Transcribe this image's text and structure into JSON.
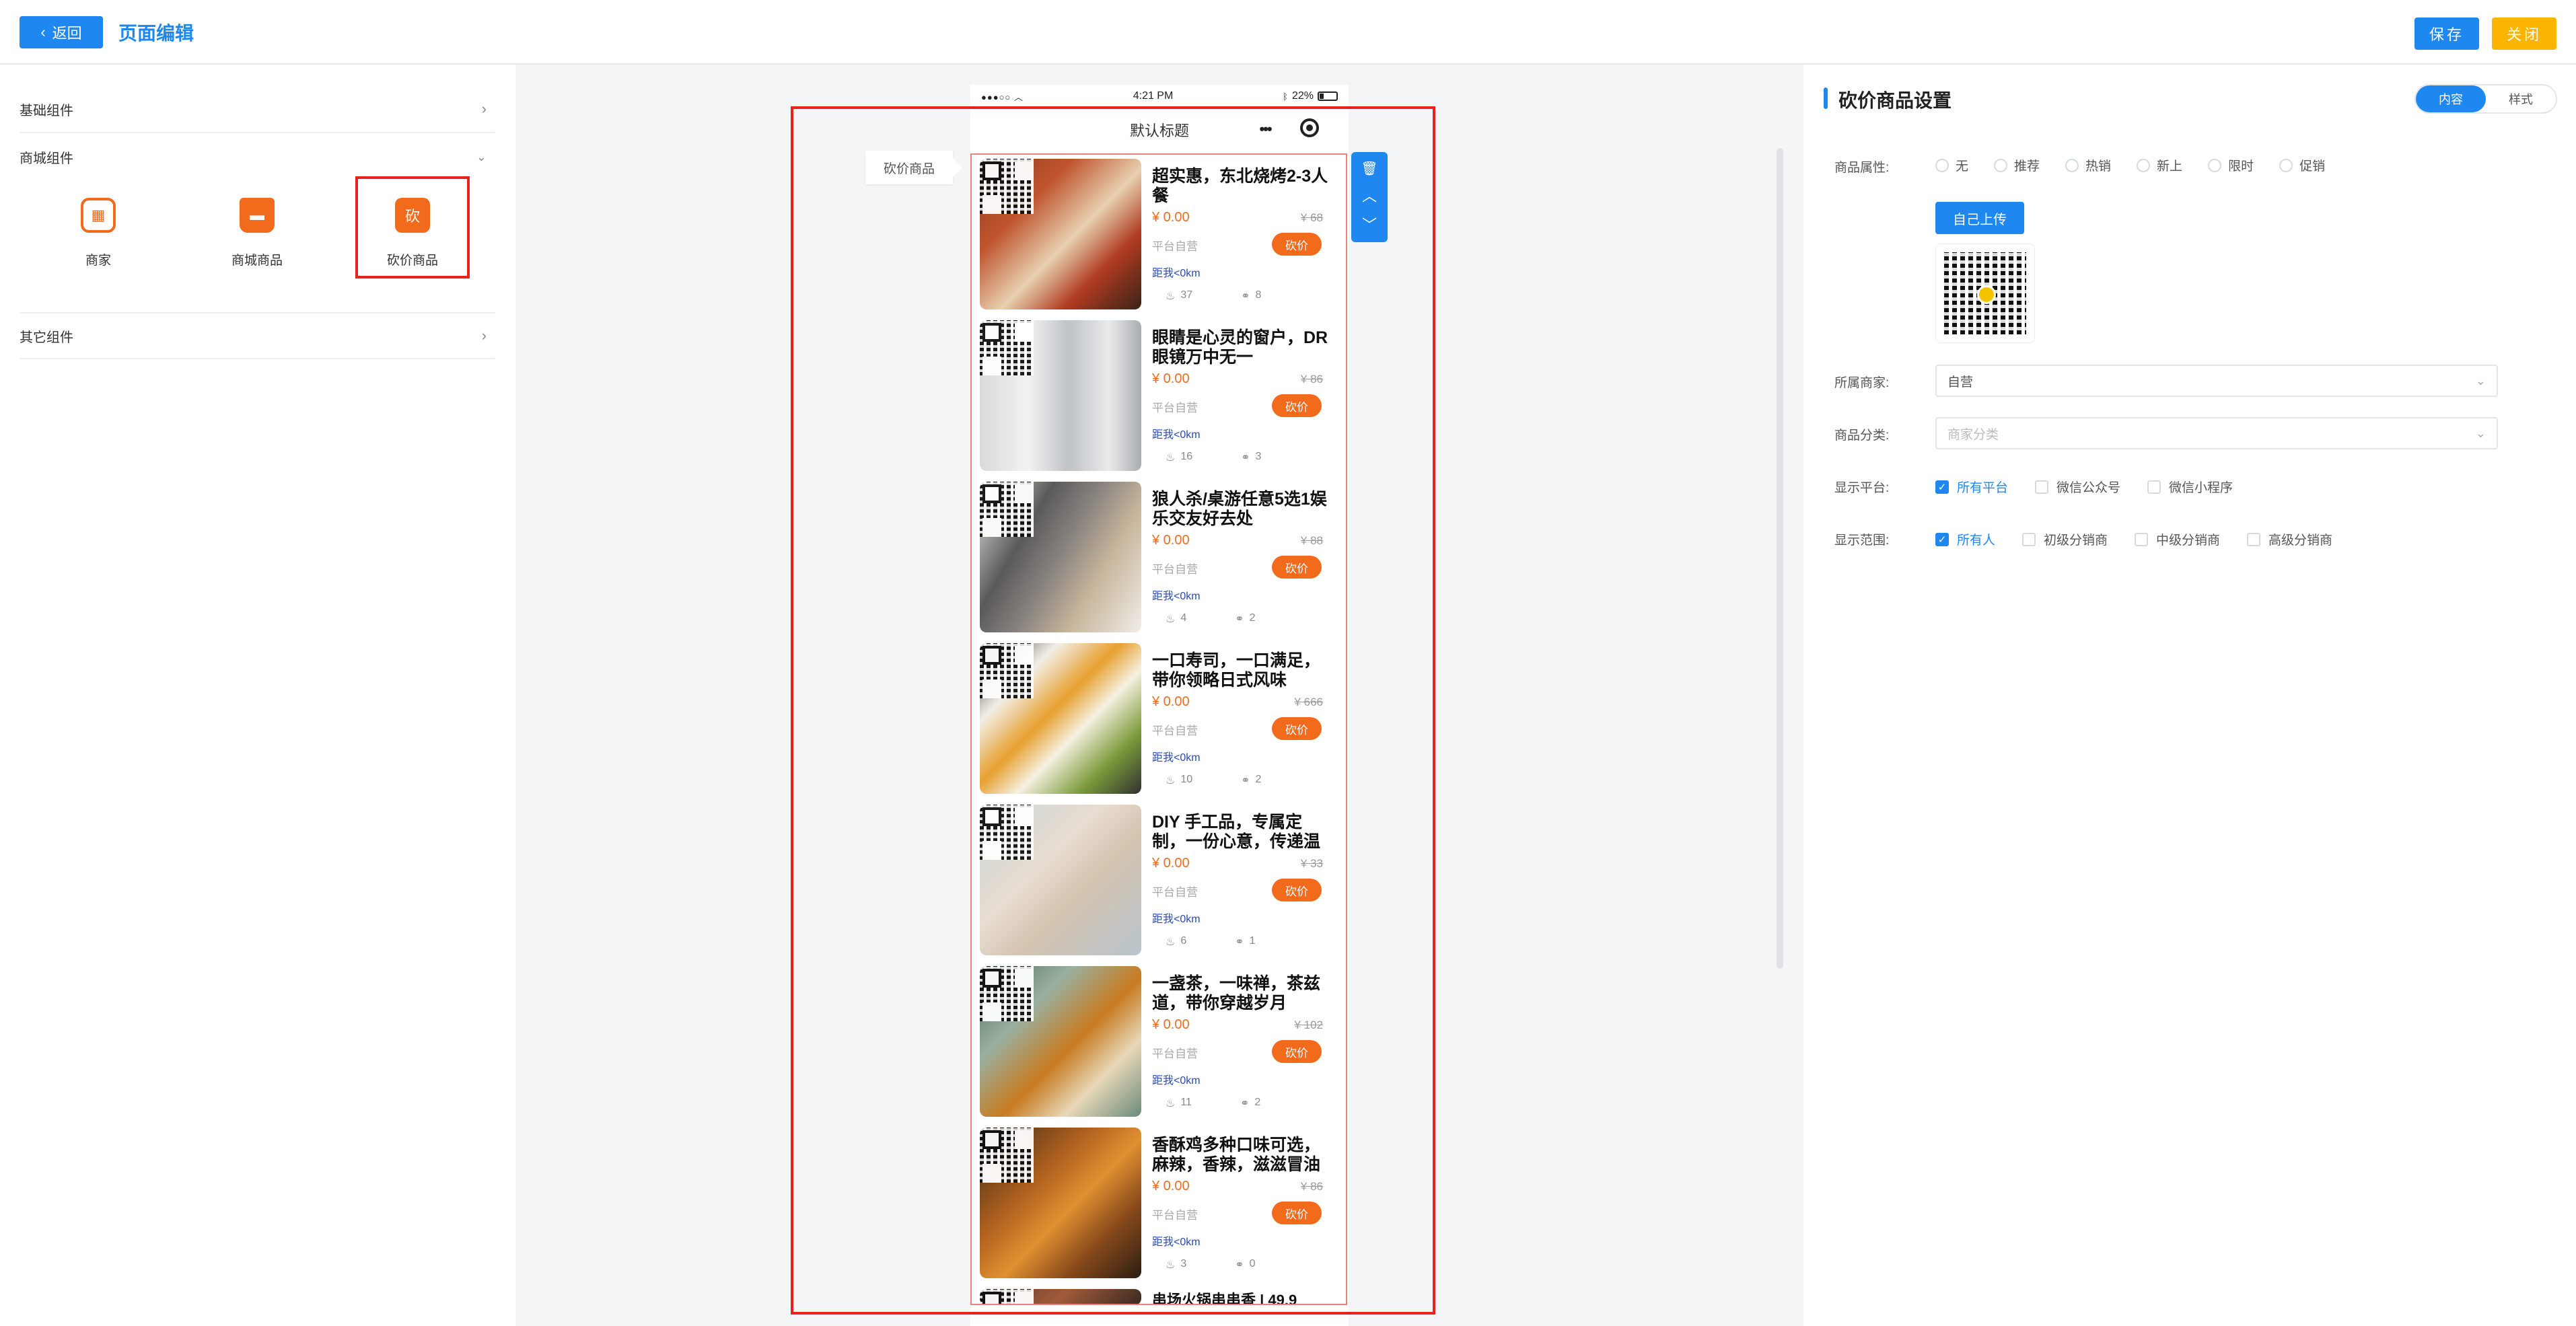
{
  "header": {
    "back_label": "返回",
    "title": "页面编辑",
    "save_label": "保存",
    "close_label": "关闭"
  },
  "left": {
    "groups": [
      {
        "label": "基础组件"
      },
      {
        "label": "商城组件"
      },
      {
        "label": "其它组件"
      }
    ],
    "components": [
      {
        "label": "商家",
        "icon": "store-icon",
        "color": "#f26a1b"
      },
      {
        "label": "商城商品",
        "icon": "shopping-bag-icon",
        "color": "#f26a1b"
      },
      {
        "label": "砍价商品",
        "icon": "bargain-icon",
        "icon_text": "砍",
        "color": "#f26a1b"
      }
    ]
  },
  "phone": {
    "status_left": "●●●○○ ︿",
    "time": "4:21 PM",
    "battery": "22%",
    "nav_title": "默认标题",
    "nav_more": "•••"
  },
  "canvas": {
    "component_tag": "砍价商品"
  },
  "products": [
    {
      "title": "超实惠，东北烧烤2-3人餐",
      "price": "¥ 0.00",
      "orig": "¥ 68",
      "seller": "平台自营",
      "btn": "砍价",
      "dist": "距我<0km",
      "views": "37",
      "shares": "8",
      "img": "linear-gradient(135deg,#8a3a1e 0%,#c0552e 30%,#e8d0b0 55%,#b03a20 75%,#3a2418 100%)"
    },
    {
      "title": "眼睛是心灵的窗户，DR眼镜万中无一",
      "price": "¥ 0.00",
      "orig": "¥ 86",
      "seller": "平台自营",
      "btn": "砍价",
      "dist": "距我<0km",
      "views": "16",
      "shares": "3",
      "img": "linear-gradient(90deg,#d8dadc 0%,#f2f2f2 30%,#bfc3c6 55%,#e9eaeb 80%,#a9adb0 100%)"
    },
    {
      "title": "狼人杀/桌游任意5选1娱乐交友好去处",
      "price": "¥ 0.00",
      "orig": "¥ 88",
      "seller": "平台自营",
      "btn": "砍价",
      "dist": "距我<0km",
      "views": "4",
      "shares": "2",
      "img": "linear-gradient(120deg,#e9e6e0 0%,#5a5a5a 30%,#8a8480 50%,#c6b59a 70%,#f0ede8 100%)"
    },
    {
      "title": "一口寿司，一口满足，带你领略日式风味",
      "price": "¥ 0.00",
      "orig": "¥ 666",
      "seller": "平台自营",
      "btn": "砍价",
      "dist": "距我<0km",
      "views": "10",
      "shares": "2",
      "img": "linear-gradient(135deg,#2a2a2a 0%,#f2efe8 25%,#e8a030 45%,#f5f0e0 60%,#7a9a3a 80%,#303030 100%)"
    },
    {
      "title": "DIY 手工品，专属定制，一份心意，传递温暖",
      "price": "¥ 0.00",
      "orig": "¥ 33",
      "seller": "平台自营",
      "btn": "砍价",
      "dist": "距我<0km",
      "views": "6",
      "shares": "1",
      "img": "linear-gradient(135deg,#c9d4da 0%,#e8ddd0 40%,#d4c4b0 60%,#b8c4cc 100%)"
    },
    {
      "title": "一盏茶，一味禅，茶兹道，带你穿越岁月",
      "price": "¥ 0.00",
      "orig": "¥ 102",
      "seller": "平台自营",
      "btn": "砍价",
      "dist": "距我<0km",
      "views": "11",
      "shares": "2",
      "img": "linear-gradient(135deg,#4a6a5a 0%,#9ab0a0 30%,#c87a20 55%,#e8d8b8 75%,#6a8a7a 100%)"
    },
    {
      "title": "香酥鸡多种口味可选，麻辣，香辣，滋滋冒油",
      "price": "¥ 0.00",
      "orig": "¥ 86",
      "seller": "平台自营",
      "btn": "砍价",
      "dist": "距我<0km",
      "views": "3",
      "shares": "0",
      "img": "linear-gradient(135deg,#3a2a1a 0%,#b0601e 35%,#e09030 55%,#8a4a1a 75%,#2a1e14 100%)"
    },
    {
      "title": "串场火锅串串香 | 49.9",
      "price": "",
      "orig": "",
      "seller": "",
      "btn": "",
      "dist": "",
      "views": "",
      "shares": "",
      "img": "linear-gradient(135deg,#5a3a2a 0%,#a05a3a 50%,#3a2a20 100%)"
    }
  ],
  "settings": {
    "title": "砍价商品设置",
    "tabs": [
      {
        "label": "内容"
      },
      {
        "label": "样式"
      }
    ],
    "attr_label": "商品属性:",
    "attrs": [
      "无",
      "推荐",
      "热销",
      "新上",
      "限时",
      "促销"
    ],
    "upload_label": "自己上传",
    "merchant_label": "所属商家:",
    "merchant_value": "自营",
    "category_label": "商品分类:",
    "category_placeholder": "商家分类",
    "platform_label": "显示平台:",
    "platforms": [
      {
        "label": "所有平台",
        "checked": true
      },
      {
        "label": "微信公众号",
        "checked": false
      },
      {
        "label": "微信小程序",
        "checked": false
      }
    ],
    "scope_label": "显示范围:",
    "scopes": [
      {
        "label": "所有人",
        "checked": true
      },
      {
        "label": "初级分销商",
        "checked": false
      },
      {
        "label": "中级分销商",
        "checked": false
      },
      {
        "label": "高级分销商",
        "checked": false
      }
    ]
  }
}
